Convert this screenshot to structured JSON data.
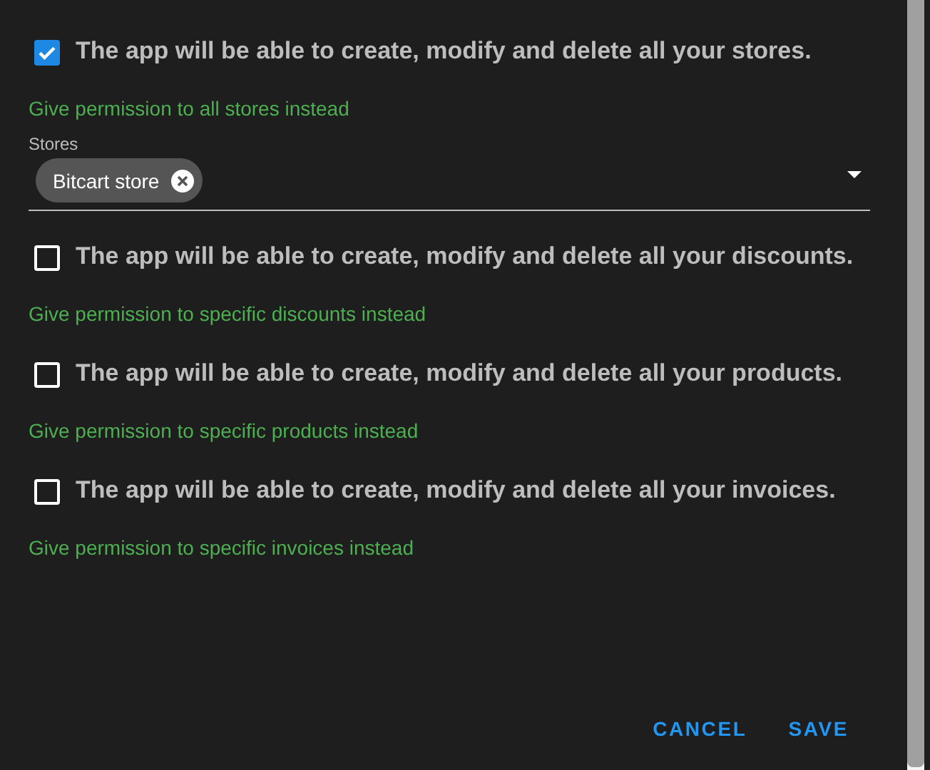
{
  "permissions": [
    {
      "checked": true,
      "label": "The app will be able to create, modify and delete all your stores.",
      "link": "Give permission to all stores instead",
      "select": {
        "label": "Stores",
        "chips": [
          "Bitcart store"
        ]
      }
    },
    {
      "checked": false,
      "label": "The app will be able to create, modify and delete all your discounts.",
      "link": "Give permission to specific discounts instead"
    },
    {
      "checked": false,
      "label": "The app will be able to create, modify and delete all your products.",
      "link": "Give permission to specific products instead"
    },
    {
      "checked": false,
      "label": "The app will be able to create, modify and delete all your invoices.",
      "link": "Give permission to specific invoices instead"
    }
  ],
  "buttons": [
    "CANCEL",
    "SAVE"
  ]
}
